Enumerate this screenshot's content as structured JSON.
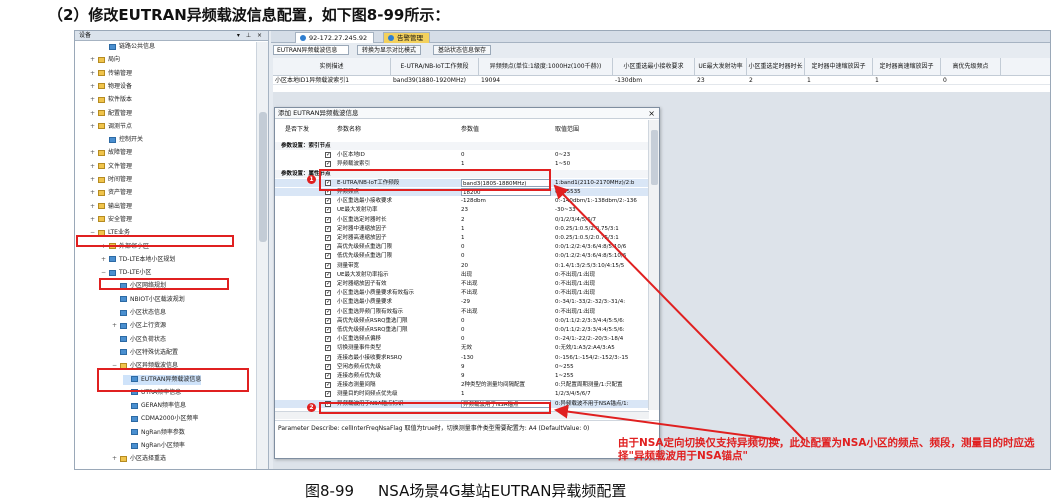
{
  "heading": "（2）修改EUTRAN异频载波信息配置，如下图8-99所示：",
  "caption": {
    "number": "图8-99",
    "text": "NSA场景4G基站EUTRAN异载频配置"
  },
  "tree": {
    "title": "设备",
    "tools": "▾ ⊥ ×",
    "items": [
      {
        "label": "链路公共信息",
        "indent": 2,
        "toggle": "",
        "icon": "file"
      },
      {
        "label": "局向",
        "indent": 1,
        "toggle": "+",
        "icon": "folder"
      },
      {
        "label": "传输管理",
        "indent": 1,
        "toggle": "+",
        "icon": "folder"
      },
      {
        "label": "物理设备",
        "indent": 1,
        "toggle": "+",
        "icon": "folder"
      },
      {
        "label": "软件版本",
        "indent": 1,
        "toggle": "+",
        "icon": "folder"
      },
      {
        "label": "配置管理",
        "indent": 1,
        "toggle": "+",
        "icon": "folder"
      },
      {
        "label": "调测节点",
        "indent": 1,
        "toggle": "+",
        "icon": "folder"
      },
      {
        "label": "控制开关",
        "indent": 2,
        "toggle": "",
        "icon": "file"
      },
      {
        "label": "故障管理",
        "indent": 1,
        "toggle": "+",
        "icon": "folder"
      },
      {
        "label": "文件管理",
        "indent": 1,
        "toggle": "+",
        "icon": "folder"
      },
      {
        "label": "时间管理",
        "indent": 1,
        "toggle": "+",
        "icon": "folder"
      },
      {
        "label": "资产管理",
        "indent": 1,
        "toggle": "+",
        "icon": "folder"
      },
      {
        "label": "输出管理",
        "indent": 1,
        "toggle": "+",
        "icon": "folder"
      },
      {
        "label": "安全管理",
        "indent": 1,
        "toggle": "+",
        "icon": "folder"
      },
      {
        "label": "LTE业务",
        "indent": 1,
        "toggle": "−",
        "icon": "folder"
      },
      {
        "label": "外部邻小区",
        "indent": 2,
        "toggle": "+",
        "icon": "folder"
      },
      {
        "label": "TD-LTE本地小区规划",
        "indent": 2,
        "toggle": "+",
        "icon": "file"
      },
      {
        "label": "TD-LTE小区",
        "indent": 2,
        "toggle": "−",
        "icon": "file"
      },
      {
        "label": "小区网络规划",
        "indent": 3,
        "toggle": "",
        "icon": "file"
      },
      {
        "label": "NBIOT小区载波规划",
        "indent": 3,
        "toggle": "",
        "icon": "file"
      },
      {
        "label": "小区状态信息",
        "indent": 3,
        "toggle": "",
        "icon": "file"
      },
      {
        "label": "小区上行资源",
        "indent": 3,
        "toggle": "+",
        "icon": "file"
      },
      {
        "label": "小区负荷状态",
        "indent": 3,
        "toggle": "",
        "icon": "file"
      },
      {
        "label": "小区特殊优选配置",
        "indent": 3,
        "toggle": "",
        "icon": "file"
      },
      {
        "label": "小区异频载波信息",
        "indent": 3,
        "toggle": "−",
        "icon": "folder"
      },
      {
        "label": "EUTRAN异频载波信息",
        "indent": 4,
        "toggle": "",
        "icon": "file"
      },
      {
        "label": "UTRA频率信息",
        "indent": 4,
        "toggle": "",
        "icon": "file"
      },
      {
        "label": "GERAN频率信息",
        "indent": 4,
        "toggle": "",
        "icon": "file"
      },
      {
        "label": "CDMA2000小区频率",
        "indent": 4,
        "toggle": "",
        "icon": "file"
      },
      {
        "label": "NgRan频率参数",
        "indent": 4,
        "toggle": "",
        "icon": "file"
      },
      {
        "label": "NgRan小区频率",
        "indent": 4,
        "toggle": "",
        "icon": "file"
      },
      {
        "label": "小区选择重选",
        "indent": 3,
        "toggle": "+",
        "icon": "folder"
      }
    ]
  },
  "tabs": [
    {
      "label": "92-172.27.245.92",
      "active": true
    },
    {
      "label": "告警管理",
      "active": false
    }
  ],
  "toolbar": {
    "field": "EUTRAN异频载波信息",
    "btn1": "转换为显示对比模式",
    "btn2": "基站状态信息保存"
  },
  "grid": {
    "headers": [
      "实例描述",
      "E-UTRA/NB-IoT工作频段",
      "异频频点(单位:1级度:1000Hz(100千赫))",
      "小区重选最小接收要求",
      "UE最大发射功率",
      "小区重选定时器时长",
      "定时器中速缩放因子",
      "定时器高速缩放因子",
      "高优先级频点"
    ],
    "row": [
      "小区本地ID1异频载波索引1",
      "band39(1880-1920MHz)",
      "19094",
      "",
      "-130dbm",
      "23",
      "2",
      "1",
      "1",
      "0"
    ]
  },
  "dialog": {
    "title": "添加 EUTRAN异频载波信息",
    "headers": [
      "是否下发",
      "参数名称",
      "参数值",
      "取值范围"
    ],
    "rows": [
      {
        "group": true,
        "name": "参数设置：索引节点"
      },
      {
        "name": "小区本地ID",
        "value": "0",
        "range": "0~23",
        "check": true
      },
      {
        "name": "异频载波索引",
        "value": "1",
        "range": "1~50",
        "check": true
      },
      {
        "group": true,
        "name": "参数设置：属性节点"
      },
      {
        "name": "E-UTRA/NB-IoT工作频段",
        "value": "band3(1805-1880MHz)",
        "range": "1:band1(2110-2170MHz)/2:b",
        "check": true,
        "hl": true
      },
      {
        "name": "异频频点",
        "value": "18200",
        "range": "0~65535",
        "check": true,
        "hl": true
      },
      {
        "name": "小区重选最小接收要求",
        "value": "-128dbm",
        "range": "0:-140dbm/1:-138dbm/2:-136",
        "check": true
      },
      {
        "name": "UE最大发射功率",
        "value": "23",
        "range": "-30~33",
        "check": true
      },
      {
        "name": "小区重选定时器时长",
        "value": "2",
        "range": "0/1/2/3/4/5/6/7",
        "check": true
      },
      {
        "name": "定时器中速缩放因子",
        "value": "1",
        "range": "0:0.25/1:0.5/2:0.75/3:1",
        "check": true
      },
      {
        "name": "定时器高速缩放因子",
        "value": "1",
        "range": "0:0.25/1:0.5/2:0.75/3:1",
        "check": true
      },
      {
        "name": "高优先级频点重选门限",
        "value": "0",
        "range": "0:0/1:2/2:4/3:6/4:8/5:10/6",
        "check": true
      },
      {
        "name": "低优先级频点重选门限",
        "value": "0",
        "range": "0:0/1:2/2:4/3:6/4:8/5:10/6",
        "check": true
      },
      {
        "name": "测量带宽",
        "value": "20",
        "range": "0:1.4/1:3/2:5/3:10/4:15/5",
        "check": true
      },
      {
        "name": "UE最大发射功率指示",
        "value": "出现",
        "range": "0:不出现/1:出现",
        "check": true
      },
      {
        "name": "定时器缩放因子有效",
        "value": "不出现",
        "range": "0:不出现/1:出现",
        "check": true
      },
      {
        "name": "小区重选最小质量要求有效指示",
        "value": "不出现",
        "range": "0:不出现/1:出现",
        "check": true
      },
      {
        "name": "小区重选最小质量要求",
        "value": "-29",
        "range": "0:-34/1:-33/2:-32/3:-31/4:",
        "check": true
      },
      {
        "name": "小区重选异频门限有效指示",
        "value": "不出现",
        "range": "0:不出现/1:出现",
        "check": true
      },
      {
        "name": "高优先级频点RSRQ重选门限",
        "value": "0",
        "range": "0:0/1:1/2:2/3:3/4:4/5:5/6:",
        "check": true
      },
      {
        "name": "低优先级频点RSRQ重选门限",
        "value": "0",
        "range": "0:0/1:1/2:2/3:3/4:4/5:5/6:",
        "check": true
      },
      {
        "name": "小区重选频点偏移",
        "value": "0",
        "range": "0:-24/1:-22/2:-20/3:-18/4",
        "check": true
      },
      {
        "name": "切换测量事件类型",
        "value": "无效",
        "range": "0:无效/1:A3/2:A4/3:A5",
        "check": true
      },
      {
        "name": "连接态最小接收要求RSRQ",
        "value": "-130",
        "range": "0:-156/1:-154/2:-152/3:-15",
        "check": true
      },
      {
        "name": "空闲态频点优先级",
        "value": "9",
        "range": "0~255",
        "check": true
      },
      {
        "name": "连接态频点优先级",
        "value": "9",
        "range": "1~255",
        "check": true
      },
      {
        "name": "连接态测量间隔",
        "value": "2种类型的测量均间隔配置",
        "range": "0:只配置周期测量/1:只配置",
        "check": true
      },
      {
        "name": "测量目的时间频点优先级",
        "value": "1",
        "range": "1/2/3/4/5/6/7",
        "check": true
      },
      {
        "name": "异频载波用于NSA锚点标识",
        "value": "异频载波用于NSA锚点",
        "range": "0:异频载波不用于NSA锚点/1:",
        "check": true,
        "hl": true
      }
    ],
    "describe": "Parameter Describe: cellInterFreqNsaFlag 取值为true时，切换测量事件类型需要配置为: A4 (DefaultValue: 0)"
  },
  "annotations": {
    "badge1": "1",
    "badge2": "2",
    "note": "由于NSA定向切换仅支持异频切换，此处配置为NSA小区的频点、频段，测量目的时应选择\"异频载波用于NSA锚点\""
  },
  "colors": {
    "annotation": "#e02020",
    "tab_active": "#ffffff",
    "tab_inactive": "#f3d15d",
    "icon_blue": "#4a8fd0",
    "icon_folder": "#f0c44c"
  }
}
